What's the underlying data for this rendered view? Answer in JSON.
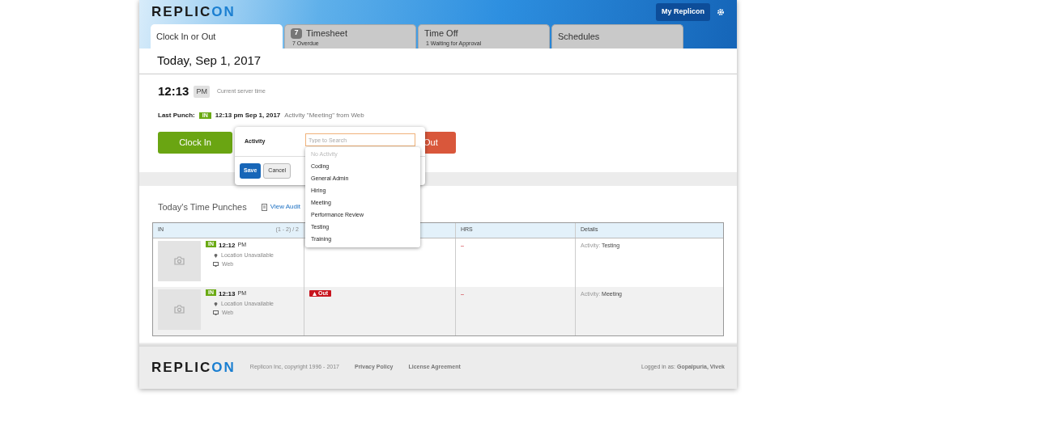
{
  "header": {
    "logo": [
      "REPLIC",
      "ON"
    ],
    "my_replicon": "My Replicon"
  },
  "tabs": [
    {
      "label": "Clock In or Out",
      "selected": true
    },
    {
      "label": "Timesheet",
      "badge": "7",
      "sub": "7 Overdue",
      "selected": false
    },
    {
      "label": "Time Off",
      "sub": "1 Waiting for Approval",
      "selected": false
    },
    {
      "label": "Schedules",
      "selected": false
    }
  ],
  "date": "Today, Sep 1, 2017",
  "clock": {
    "time": "12:13",
    "ampm": "PM",
    "note": "Current server time"
  },
  "last_punch": {
    "label": "Last Punch:",
    "badge": "IN",
    "time": "12:13 pm Sep 1, 2017",
    "detail": "Activity \"Meeting\" from Web"
  },
  "clock_in_button": "Clock In",
  "clock_out_button": "Out",
  "popover": {
    "label": "Activity",
    "placeholder": "Type to Search",
    "save": "Save",
    "cancel": "Cancel",
    "options": [
      {
        "label": "No Activity",
        "disabled": true
      },
      {
        "label": "Coding",
        "disabled": false
      },
      {
        "label": "General Admin",
        "disabled": false
      },
      {
        "label": "Hiring",
        "disabled": false
      },
      {
        "label": "Meeting",
        "disabled": false
      },
      {
        "label": "Performance Review",
        "disabled": false
      },
      {
        "label": "Testing",
        "disabled": false
      },
      {
        "label": "Training",
        "disabled": false
      }
    ]
  },
  "punches": {
    "title": "Today's Time Punches",
    "audit_link": "View Audit",
    "columns": {
      "in": "IN",
      "range": "(1 - 2) / 2",
      "hrs": "HRS",
      "details": "Details"
    },
    "rows": [
      {
        "in_badge": "IN",
        "time": "12:12",
        "ampm": "PM",
        "location": "Location Unavailable",
        "device": "Web",
        "hrs": "–",
        "detail_label": "Activity:",
        "detail_value": "Testing"
      },
      {
        "in_badge": "IN",
        "time": "12:13",
        "ampm": "PM",
        "location": "Location Unavailable",
        "device": "Web",
        "out_badge": "Out",
        "hrs": "–",
        "detail_label": "Activity:",
        "detail_value": "Meeting"
      }
    ]
  },
  "footer": {
    "logo": [
      "REPLIC",
      "ON"
    ],
    "copyright": "Replicon Inc, copyright 1996 - 2017",
    "links": [
      "Privacy Policy",
      "License Agreement"
    ],
    "logged_in_label": "Logged in as:",
    "user": "Gopalpuria, Vivek"
  }
}
